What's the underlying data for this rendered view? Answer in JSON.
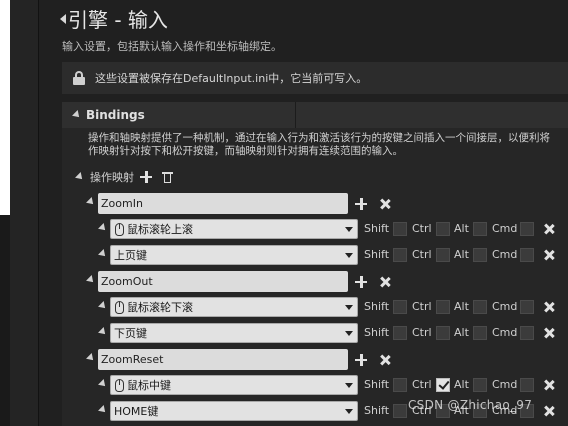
{
  "page": {
    "title": "引擎 - 输入",
    "subtitle": "输入设置，包括默认输入操作和坐标轴绑定。",
    "notice": "这些设置被保存在DefaultInput.ini中，它当前可写入。"
  },
  "bindings": {
    "header": "Bindings",
    "description_line1": "操作和轴映射提供了一种机制，通过在输入行为和激活该行为的按键之间插入一个间接层，以便利将",
    "description_line2": "作映射针对按下和松开按键，而轴映射则针对拥有连续范围的输入。",
    "action_mappings_label": "操作映射",
    "groups": [
      {
        "name": "ZoomIn",
        "keys": [
          {
            "label": "鼠标滚轮上滚",
            "icon": "mouse-icon",
            "shift": false,
            "ctrl": false,
            "alt": false,
            "cmd": false
          },
          {
            "label": "上页键",
            "icon": "",
            "shift": false,
            "ctrl": false,
            "alt": false,
            "cmd": false
          }
        ]
      },
      {
        "name": "ZoomOut",
        "keys": [
          {
            "label": "鼠标滚轮下滚",
            "icon": "mouse-icon",
            "shift": false,
            "ctrl": false,
            "alt": false,
            "cmd": false
          },
          {
            "label": "下页键",
            "icon": "",
            "shift": false,
            "ctrl": false,
            "alt": false,
            "cmd": false
          }
        ]
      },
      {
        "name": "ZoomReset",
        "keys": [
          {
            "label": "鼠标中键",
            "icon": "mouse-icon",
            "shift": false,
            "ctrl": true,
            "alt": false,
            "cmd": false
          },
          {
            "label": "HOME键",
            "icon": "",
            "shift": false,
            "ctrl": false,
            "alt": false,
            "cmd": false
          }
        ]
      }
    ]
  },
  "modifiers": {
    "shift": "Shift",
    "ctrl": "Ctrl",
    "alt": "Alt",
    "cmd": "Cmd"
  },
  "watermark": "CSDN @Zhichao_97"
}
